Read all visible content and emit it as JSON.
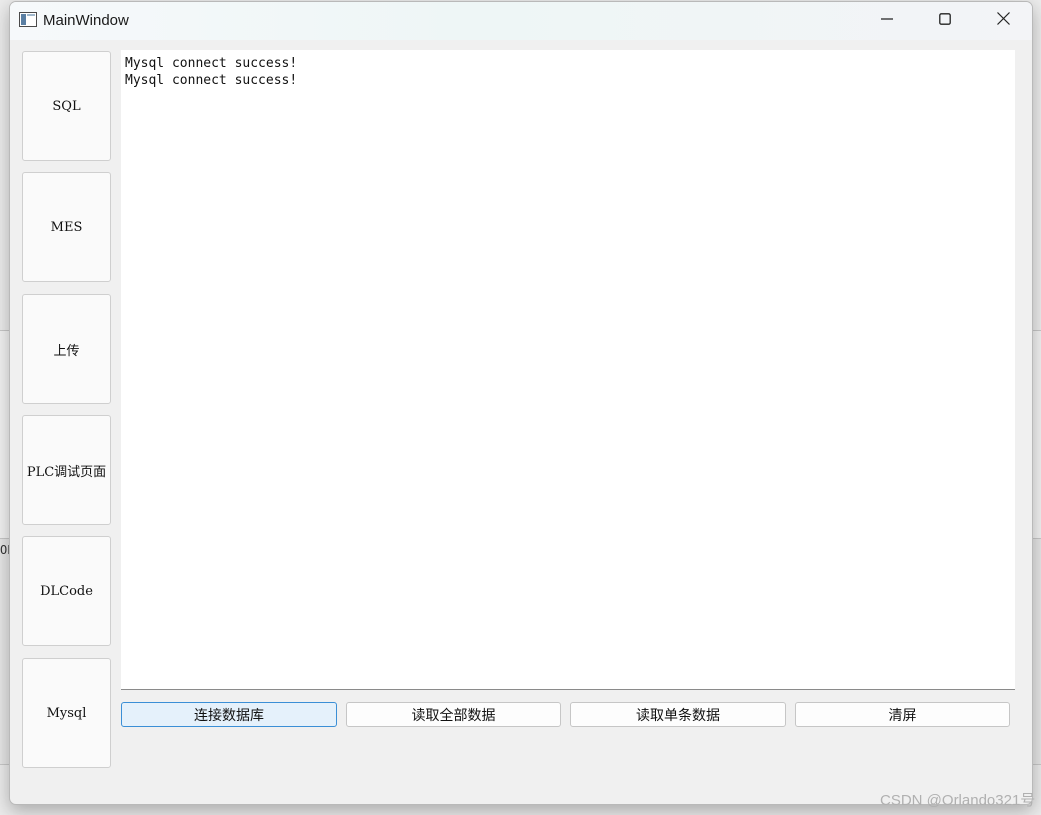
{
  "window": {
    "title": "MainWindow"
  },
  "sidebar": {
    "items": [
      {
        "label": "SQL"
      },
      {
        "label": "MES"
      },
      {
        "label": "上传"
      },
      {
        "label": "PLC调试页面"
      },
      {
        "label": "DLCode"
      },
      {
        "label": "Mysql"
      }
    ]
  },
  "log": {
    "lines": [
      "Mysql connect success!",
      "Mysql connect success!"
    ]
  },
  "actions": {
    "connect_db": "连接数据库",
    "read_all": "读取全部数据",
    "read_single": "读取单条数据",
    "clear": "清屏"
  },
  "background": {
    "fragment": "OE"
  },
  "watermark": "CSDN @Orlando321号",
  "colors": {
    "accent": "#3b8fd6",
    "selected_bg": "#e5f1fb"
  },
  "icons": [
    "app-window-icon",
    "minimize-icon",
    "maximize-icon",
    "close-icon"
  ]
}
